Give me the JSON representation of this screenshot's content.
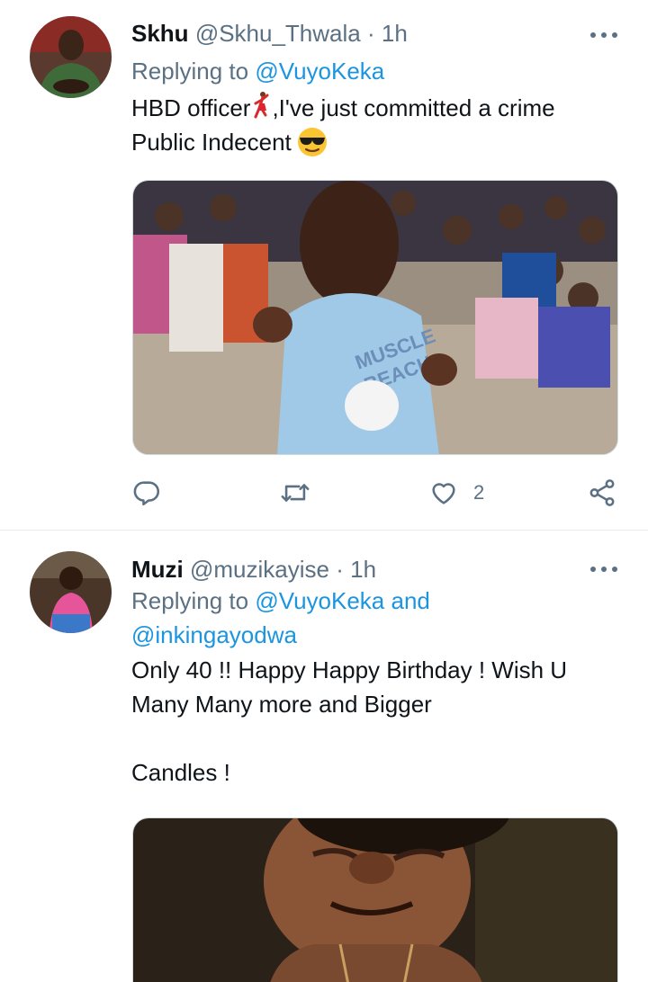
{
  "tweets": [
    {
      "name": "Skhu",
      "handle": "@Skhu_Thwala",
      "separator": "·",
      "time": "1h",
      "replying_prefix": "Replying to",
      "replying_to": "@VuyoKeka",
      "body_part1": "HBD officer",
      "body_part2": ",I've just committed a crime",
      "body_line2": "Public Indecent",
      "like_count": "2",
      "icons": {
        "reply": "reply-icon",
        "retweet": "retweet-icon",
        "like": "heart-icon",
        "share": "share-icon",
        "more": "more-icon"
      }
    },
    {
      "name": "Muzi",
      "handle": "@muzikayise",
      "separator": "·",
      "time": "1h",
      "replying_prefix": "Replying to",
      "replying_to_1": "@VuyoKeka",
      "replying_and": "and",
      "replying_to_2": "@inkingayodwa",
      "body_line1": "Only 40 !! Happy Happy Birthday ! Wish U",
      "body_line2": "Many Many more and Bigger",
      "body_line4": "Candles !"
    }
  ],
  "colors": {
    "link": "#1b95e0",
    "secondary_text": "#5b7083",
    "primary_text": "#0f1419",
    "divider": "#e6ecf0"
  }
}
